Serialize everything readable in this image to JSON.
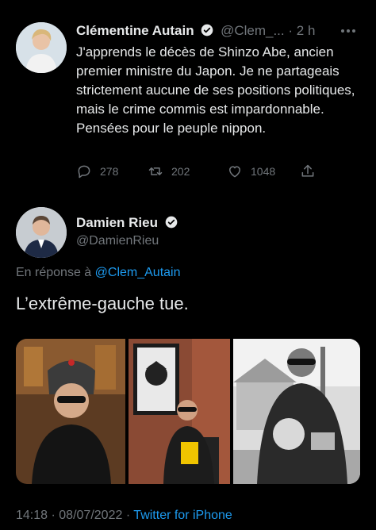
{
  "reply_context": {
    "author": {
      "name": "Clémentine Autain",
      "handle": "@Clem_...",
      "separator": "·",
      "time": "2 h",
      "more_icon": "more-dots-icon"
    },
    "text": "J'apprends le décès de Shinzo Abe, ancien premier ministre du Japon. Je ne partageais strictement aucune de ses positions politiques, mais le crime commis est impardonnable. Pensées pour le peuple nippon.",
    "actions": {
      "replies": "278",
      "retweets": "202",
      "likes": "1048"
    }
  },
  "main_tweet": {
    "author": {
      "name": "Damien Rieu",
      "handle": "@DamienRieu"
    },
    "reply_prefix": "En réponse à",
    "reply_to": "@Clem_Autain",
    "text": "L’extrême-gauche tue.",
    "footer": {
      "time": "14:18",
      "sep1": "·",
      "date": "08/07/2022",
      "sep2": "·",
      "source": "Twitter for iPhone"
    }
  },
  "colors": {
    "background": "#000000",
    "text": "#e7e9ea",
    "muted": "#71767b",
    "accent": "#1d9bf0"
  }
}
